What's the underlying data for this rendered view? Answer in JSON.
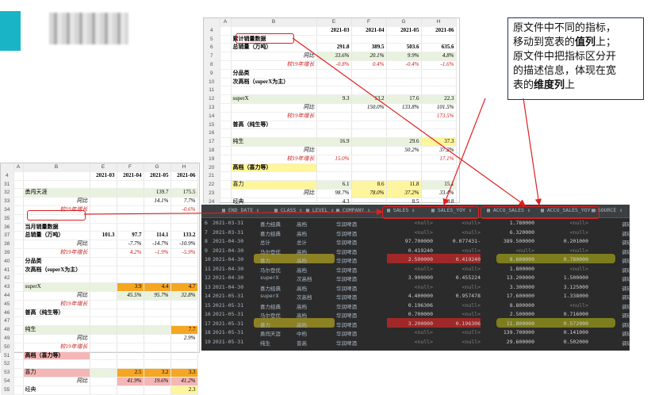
{
  "note": {
    "l1": "原文件中不同的指标，",
    "l2a": "移动到宽表的",
    "l2b": "值列",
    "l2c": "上；",
    "l3": "原文件中把指标区分开",
    "l4": "的描述信息，体现在宽",
    "l5a": "表的",
    "l5b": "维度列",
    "l5c": "上"
  },
  "sheet1": {
    "cols": [
      "",
      "A",
      "B",
      "E",
      "F",
      "G",
      "H"
    ],
    "rows": [
      {
        "n": "4",
        "b": "",
        "e": "2021-03",
        "f": "2021-04",
        "g": "2021-05",
        "h": "2021-06",
        "cls": "b"
      },
      {
        "n": "5",
        "b": "累计销量数据",
        "e": "",
        "f": "",
        "g": "",
        "h": "",
        "cls": "b"
      },
      {
        "n": "6",
        "b": "总销量（万吨）",
        "e": "291.8",
        "f": "389.5",
        "g": "503.6",
        "h": "635.6",
        "cls": "b"
      },
      {
        "n": "7",
        "b": "同比",
        "e": "33.6%",
        "f": "20.1%",
        "g": "9.9%",
        "h": "4.8%",
        "cls": "it"
      },
      {
        "n": "8",
        "b": "较19年增长",
        "e": "-0.8%",
        "f": "0.4%",
        "g": "-0.4%",
        "h": "-1.6%",
        "cls": "red"
      },
      {
        "n": "9",
        "b": "分品类",
        "e": "",
        "f": "",
        "g": "",
        "h": "",
        "cls": "b"
      },
      {
        "n": "10",
        "b": "次高档（superX为主）",
        "e": "",
        "f": "",
        "g": "",
        "h": "",
        "cls": "b"
      },
      {
        "n": "11",
        "b": "",
        "e": "",
        "f": "",
        "g": "",
        "h": "",
        "cls": ""
      },
      {
        "n": "12",
        "b": "superX",
        "e": "9.3",
        "f": "13.2",
        "g": "17.6",
        "h": "22.3",
        "cls": ""
      },
      {
        "n": "13",
        "b": "同比",
        "e": "",
        "f": "150.0%",
        "g": "133.8%",
        "h": "101.5%",
        "cls": "it"
      },
      {
        "n": "14",
        "b": "较19年增长",
        "e": "",
        "f": "",
        "g": "",
        "h": "173.5%",
        "cls": "red"
      },
      {
        "n": "15",
        "b": "普高（纯生等）",
        "e": "",
        "f": "",
        "g": "",
        "h": "",
        "cls": "b"
      },
      {
        "n": "16",
        "b": "",
        "e": "",
        "f": "",
        "g": "",
        "h": "",
        "cls": ""
      },
      {
        "n": "17",
        "b": "纯生",
        "e": "16.9",
        "f": "",
        "g": "29.6",
        "h": "37.3",
        "cls": ""
      },
      {
        "n": "18",
        "b": "同比",
        "e": "",
        "f": "",
        "g": "50.2%",
        "h": "37.2%",
        "cls": "it"
      },
      {
        "n": "19",
        "b": "较19年增长",
        "e": "15.0%",
        "f": "",
        "g": "",
        "h": "17.1%",
        "cls": "red"
      },
      {
        "n": "20",
        "b": "高档（喜力等）",
        "e": "",
        "f": "",
        "g": "",
        "h": "",
        "cls": "b"
      },
      {
        "n": "21",
        "b": "",
        "e": "",
        "f": "",
        "g": "",
        "h": "",
        "cls": ""
      },
      {
        "n": "22",
        "b": "喜力",
        "e": "6.1",
        "f": "8.6",
        "g": "11.8",
        "h": "15.1",
        "cls": ""
      },
      {
        "n": "23",
        "b": "同比",
        "e": "98.7%",
        "f": "78.0%",
        "g": "37.2%",
        "h": "33.4%",
        "cls": "it"
      },
      {
        "n": "24",
        "b": "经典",
        "e": "4.3",
        "f": "",
        "g": "8.5",
        "h": "10.8",
        "cls": ""
      }
    ]
  },
  "sheet2": {
    "cols": [
      "",
      "A",
      "B",
      "E",
      "F",
      "G",
      "H"
    ],
    "rows": [
      {
        "n": "4",
        "b": "",
        "e": "2021-03",
        "f": "2021-04",
        "g": "2021-05",
        "h": "2021-06",
        "cls": "b"
      },
      {
        "n": "31",
        "b": "",
        "e": "",
        "f": "",
        "g": "",
        "h": "",
        "cls": ""
      },
      {
        "n": "32",
        "b": "勇闯天涯",
        "e": "",
        "f": "",
        "g": "139.7",
        "h": "175.5",
        "cls": ""
      },
      {
        "n": "33",
        "b": "同比",
        "e": "",
        "f": "",
        "g": "14.1%",
        "h": "7.7%",
        "cls": "it"
      },
      {
        "n": "34",
        "b": "较19年增长",
        "e": "",
        "f": "",
        "g": "",
        "h": "-0.6%",
        "cls": "red"
      },
      {
        "n": "35",
        "b": "",
        "e": "",
        "f": "",
        "g": "",
        "h": "",
        "cls": ""
      },
      {
        "n": "36",
        "b": "当月销量数据",
        "e": "",
        "f": "",
        "g": "",
        "h": "",
        "cls": "b"
      },
      {
        "n": "37",
        "b": "总销量（万吨）",
        "e": "101.3",
        "f": "97.7",
        "g": "114.1",
        "h": "133.2",
        "cls": "b"
      },
      {
        "n": "38",
        "b": "同比",
        "e": "",
        "f": "-7.7%",
        "g": "-14.7%",
        "h": "-10.9%",
        "cls": "it"
      },
      {
        "n": "39",
        "b": "较19年增长",
        "e": "",
        "f": "4.2%",
        "g": "-1.9%",
        "h": "-5.9%",
        "cls": "red"
      },
      {
        "n": "40",
        "b": "分品类",
        "e": "",
        "f": "",
        "g": "",
        "h": "",
        "cls": "b"
      },
      {
        "n": "41",
        "b": "次高档（superX为主）",
        "e": "",
        "f": "",
        "g": "",
        "h": "",
        "cls": "b"
      },
      {
        "n": "42",
        "b": "",
        "e": "",
        "f": "",
        "g": "",
        "h": "",
        "cls": ""
      },
      {
        "n": "43",
        "b": "superX",
        "e": "",
        "f": "3.9",
        "g": "4.4",
        "h": "4.7",
        "cls": ""
      },
      {
        "n": "44",
        "b": "同比",
        "e": "",
        "f": "45.5%",
        "g": "95.7%",
        "h": "32.8%",
        "cls": "it"
      },
      {
        "n": "45",
        "b": "较19年增长",
        "e": "",
        "f": "",
        "g": "",
        "h": "",
        "cls": "red"
      },
      {
        "n": "46",
        "b": "普高（纯生等）",
        "e": "",
        "f": "",
        "g": "",
        "h": "",
        "cls": "b"
      },
      {
        "n": "47",
        "b": "",
        "e": "",
        "f": "",
        "g": "",
        "h": "",
        "cls": ""
      },
      {
        "n": "48",
        "b": "纯生",
        "e": "",
        "f": "",
        "g": "",
        "h": "7.7",
        "cls": ""
      },
      {
        "n": "49",
        "b": "同比",
        "e": "",
        "f": "",
        "g": "",
        "h": "2.9%",
        "cls": "it"
      },
      {
        "n": "50",
        "b": "较19年增长",
        "e": "",
        "f": "",
        "g": "",
        "h": "",
        "cls": "red"
      },
      {
        "n": "51",
        "b": "高档（喜力等）",
        "e": "",
        "f": "",
        "g": "",
        "h": "",
        "cls": "b"
      },
      {
        "n": "52",
        "b": "",
        "e": "",
        "f": "",
        "g": "",
        "h": "",
        "cls": ""
      },
      {
        "n": "53",
        "b": "喜力",
        "e": "",
        "f": "2.5",
        "g": "3.2",
        "h": "3.3",
        "cls": ""
      },
      {
        "n": "54",
        "b": "同比",
        "e": "",
        "f": "41.9%",
        "g": "19.6%",
        "h": "41.2%",
        "cls": "it"
      },
      {
        "n": "55",
        "b": "经典",
        "e": "",
        "f": "",
        "g": "",
        "h": "2.3",
        "cls": ""
      }
    ]
  },
  "grid": {
    "headers": [
      "END_DATE",
      "CLASS",
      "LEVEL",
      "COMPANY",
      "SALES",
      "SALES_YOY",
      "ACCU_SALES",
      "ACCU_SALES_YOY",
      "SOURCE"
    ],
    "rows": [
      {
        "n": "6",
        "d": "2021-03-31",
        "c": "喜力经典",
        "l": "高档",
        "co": "华润啤酒",
        "s": "<null>",
        "sy": "<null>",
        "as": "1.780000",
        "ay": "<null>",
        "src": "调研"
      },
      {
        "n": "7",
        "d": "2021-03-31",
        "c": "喜力经典",
        "l": "高档",
        "co": "华润啤酒",
        "s": "<null>",
        "sy": "<null>",
        "as": "6.320000",
        "ay": "<null>",
        "src": "调研"
      },
      {
        "n": "8",
        "d": "2021-04-30",
        "c": "总计",
        "l": "总计",
        "co": "华润啤酒",
        "s": "97.700000",
        "sy": "-0.077431",
        "as": "389.500000",
        "ay": "0.201000",
        "src": "调研"
      },
      {
        "n": "9",
        "d": "2021-04-30",
        "c": "马尔登优",
        "l": "高档",
        "co": "华润啤酒",
        "s": "0.419240",
        "sy": "<null>",
        "as": "<null>",
        "ay": "<null>",
        "src": "调研"
      },
      {
        "n": "10",
        "d": "2021-04-30",
        "c": "喜力",
        "l": "高档",
        "co": "华润啤酒",
        "s": "2.500000",
        "sy": "0.419240",
        "as": "8.600000",
        "ay": "0.780000",
        "src": "调研"
      },
      {
        "n": "11",
        "d": "2021-04-30",
        "c": "马尔登优",
        "l": "高档",
        "co": "华润啤酒",
        "s": "<null>",
        "sy": "<null>",
        "as": "1.800000",
        "ay": "<null>",
        "src": "调研"
      },
      {
        "n": "12",
        "d": "2021-04-30",
        "c": "superX",
        "l": "次高档",
        "co": "华润啤酒",
        "s": "3.900000",
        "sy": "0.455224",
        "as": "13.200000",
        "ay": "1.500000",
        "src": "调研"
      },
      {
        "n": "13",
        "d": "2021-04-30",
        "c": "喜力经典",
        "l": "高档",
        "co": "华润啤酒",
        "s": "<null>",
        "sy": "<null>",
        "as": "3.300000",
        "ay": "3.125000",
        "src": "调研"
      },
      {
        "n": "14",
        "d": "2021-05-31",
        "c": "superX",
        "l": "次高档",
        "co": "华润啤酒",
        "s": "4.400000",
        "sy": "0.957478",
        "as": "17.600000",
        "ay": "1.338000",
        "src": "调研"
      },
      {
        "n": "15",
        "d": "2021-05-31",
        "c": "喜力经典",
        "l": "高档",
        "co": "华润啤酒",
        "s": "0.196306",
        "sy": "<null>",
        "as": "8.800000",
        "ay": "<null>",
        "src": "调研"
      },
      {
        "n": "16",
        "d": "2021-05-31",
        "c": "马尔登优",
        "l": "高档",
        "co": "华润啤酒",
        "s": "0.700000",
        "sy": "<null>",
        "as": "2.500000",
        "ay": "0.716000",
        "src": "调研"
      },
      {
        "n": "17",
        "d": "2021-05-31",
        "c": "喜力",
        "l": "高档",
        "co": "华润啤酒",
        "s": "3.200000",
        "sy": "0.196306",
        "as": "11.800000",
        "ay": "0.572000",
        "src": "调研"
      },
      {
        "n": "18",
        "d": "2021-05-31",
        "c": "勇闯天涯",
        "l": "中档",
        "co": "华润啤酒",
        "s": "<null>",
        "sy": "<null>",
        "as": "139.700000",
        "ay": "0.141000",
        "src": "调研"
      },
      {
        "n": "19",
        "d": "2021-05-31",
        "c": "纯生",
        "l": "普高",
        "co": "华润啤酒",
        "s": "<null>",
        "sy": "<null>",
        "as": "29.600000",
        "ay": "0.502000",
        "src": "调研"
      }
    ]
  }
}
